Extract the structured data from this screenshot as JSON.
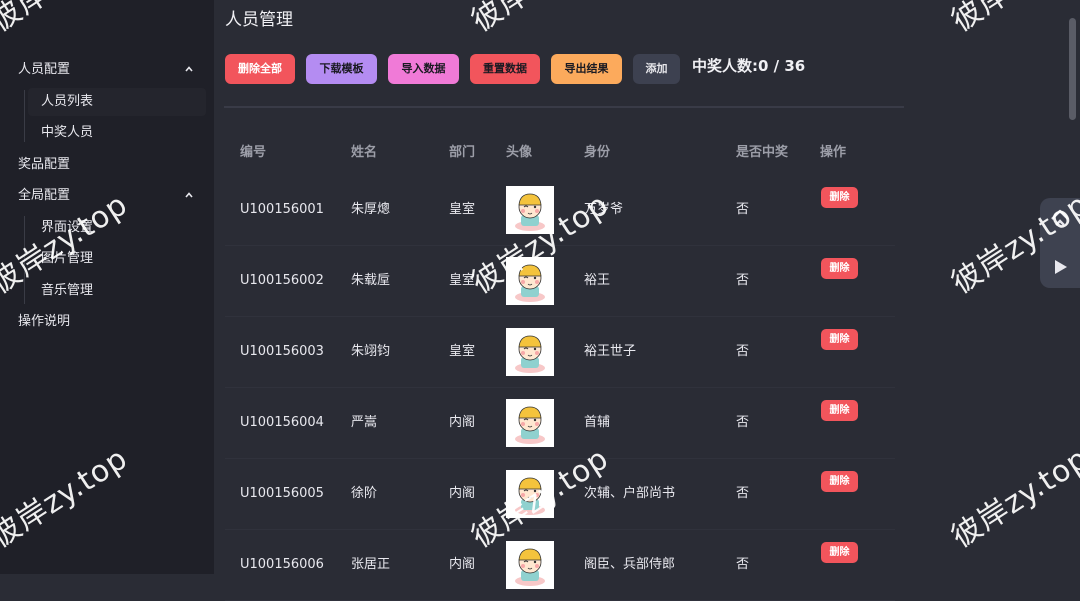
{
  "sidebar": {
    "staff_config": "人员配置",
    "staff_list": "人员列表",
    "winners": "中奖人员",
    "prize_config": "奖品配置",
    "global_config": "全局配置",
    "ui_settings": "界面设置",
    "image_management": "图片管理",
    "music_management": "音乐管理",
    "instructions": "操作说明"
  },
  "main": {
    "title": "人员管理",
    "toolbar": {
      "delete_all": "删除全部",
      "download_template": "下载模板",
      "import_data": "导入数据",
      "reset_data": "重置数据",
      "export_results": "导出结果",
      "add": "添加"
    },
    "winner_count": "中奖人数:0 / 36",
    "table": {
      "headers": [
        "编号",
        "姓名",
        "部门",
        "头像",
        "身份",
        "是否中奖",
        "操作"
      ],
      "rows": [
        {
          "id": "U100156001",
          "name": "朱厚熜",
          "dept": "皇室",
          "identity": "万岁爷",
          "won": "否",
          "action": "删除"
        },
        {
          "id": "U100156002",
          "name": "朱载垕",
          "dept": "皇室",
          "identity": "裕王",
          "won": "否",
          "action": "删除"
        },
        {
          "id": "U100156003",
          "name": "朱翊钧",
          "dept": "皇室",
          "identity": "裕王世子",
          "won": "否",
          "action": "删除"
        },
        {
          "id": "U100156004",
          "name": "严嵩",
          "dept": "内阁",
          "identity": "首辅",
          "won": "否",
          "action": "删除"
        },
        {
          "id": "U100156005",
          "name": "徐阶",
          "dept": "内阁",
          "identity": "次辅、户部尚书",
          "won": "否",
          "action": "删除"
        },
        {
          "id": "U100156006",
          "name": "张居正",
          "dept": "内阁",
          "identity": "阁臣、兵部侍郎",
          "won": "否",
          "action": "删除"
        }
      ]
    }
  },
  "watermark": "彼岸zy.top",
  "icons": {
    "expand_1": "chevron-up-icon",
    "expand_2": "chevron-up-icon",
    "avatar": "cartoon-avatar-icon",
    "float_top": "back-to-top-icon",
    "float_play": "play-icon"
  },
  "colors": {
    "background": "#2a2c35",
    "sidebar": "#1f2028",
    "danger": "#f2555c",
    "purple": "#b48cf2",
    "pink": "#f07ad7",
    "orange": "#fcaa5c"
  }
}
